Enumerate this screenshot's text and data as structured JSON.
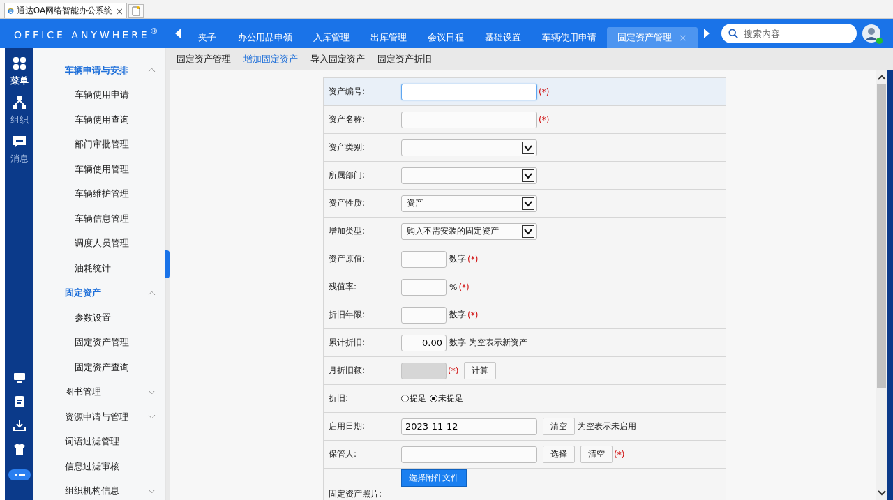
{
  "browser_tab": {
    "title": "通达OA网络智能办公系统",
    "close": "×"
  },
  "header": {
    "logo": "OFFICE ANYWHERE$^{®}$",
    "tabs": [
      {
        "label": "夹子",
        "selected": false,
        "closable": false
      },
      {
        "label": "办公用品申领",
        "selected": false,
        "closable": false
      },
      {
        "label": "入库管理",
        "selected": false,
        "closable": false
      },
      {
        "label": "出库管理",
        "selected": false,
        "closable": false
      },
      {
        "label": "会议日程",
        "selected": false,
        "closable": false
      },
      {
        "label": "基础设置",
        "selected": false,
        "closable": false
      },
      {
        "label": "车辆使用申请",
        "selected": false,
        "closable": false
      },
      {
        "label": "固定资产管理",
        "selected": true,
        "closable": true
      }
    ],
    "close_glyph": "×",
    "search": {
      "placeholder": "搜索内容"
    },
    "avatar": {
      "online": true
    }
  },
  "rail": {
    "items": [
      {
        "kind": "apps",
        "label": "菜单",
        "selected": true
      },
      {
        "kind": "org",
        "label": "组织",
        "selected": false
      },
      {
        "kind": "chat",
        "label": "消息",
        "selected": false
      }
    ],
    "tools": [
      {
        "kind": "monitor"
      },
      {
        "kind": "note"
      },
      {
        "kind": "download"
      },
      {
        "kind": "shirt"
      },
      {
        "kind": "toggle",
        "expanded": true
      }
    ]
  },
  "sidebar": {
    "items": [
      {
        "label": "车辆申请与安排",
        "kind": "group",
        "expanded": true,
        "children": [
          {
            "label": "车辆使用申请"
          },
          {
            "label": "车辆使用查询"
          },
          {
            "label": "部门审批管理"
          },
          {
            "label": "车辆使用管理"
          },
          {
            "label": "车辆维护管理"
          },
          {
            "label": "车辆信息管理"
          },
          {
            "label": "调度人员管理"
          },
          {
            "label": "油耗统计"
          }
        ]
      },
      {
        "label": "固定资产",
        "kind": "group",
        "expanded": true,
        "children": [
          {
            "label": "参数设置"
          },
          {
            "label": "固定资产管理"
          },
          {
            "label": "固定资产查询"
          }
        ]
      },
      {
        "label": "图书管理",
        "kind": "group",
        "expanded": false
      },
      {
        "label": "资源申请与管理",
        "kind": "group",
        "expanded": false
      },
      {
        "label": "词语过滤管理",
        "kind": "link"
      },
      {
        "label": "信息过滤审核",
        "kind": "link"
      },
      {
        "label": "组织机构信息",
        "kind": "group",
        "expanded": false
      }
    ]
  },
  "subtabs": [
    {
      "label": "固定资产管理",
      "selected": false
    },
    {
      "label": "增加固定资产",
      "selected": true
    },
    {
      "label": "导入固定资产",
      "selected": false
    },
    {
      "label": "固定资产折旧",
      "selected": false
    }
  ],
  "form": {
    "rows": [
      {
        "label": "资产编号:",
        "kind": "text",
        "focused": true,
        "parts": [
          {
            "kind": "required",
            "text": "(*)"
          }
        ]
      },
      {
        "label": "资产名称:",
        "kind": "text",
        "focused": false,
        "parts": [
          {
            "kind": "required",
            "text": "(*)"
          }
        ]
      },
      {
        "label": "资产类别:",
        "kind": "select",
        "value": ""
      },
      {
        "label": "所属部门:",
        "kind": "select",
        "value": ""
      },
      {
        "label": "资产性质:",
        "kind": "select",
        "value": "资产"
      },
      {
        "label": "增加类型:",
        "kind": "select",
        "value": "购入不需安装的固定资产"
      },
      {
        "label": "资产原值:",
        "kind": "number",
        "disabled": false,
        "parts": [
          {
            "kind": "note",
            "text": "数字"
          },
          {
            "kind": "required",
            "text": "(*)"
          }
        ]
      },
      {
        "label": "残值率:",
        "kind": "number",
        "disabled": false,
        "parts": [
          {
            "kind": "note",
            "text": "%"
          },
          {
            "kind": "required",
            "text": "(*)"
          }
        ]
      },
      {
        "label": "折旧年限:",
        "kind": "number",
        "disabled": false,
        "parts": [
          {
            "kind": "note",
            "text": "数字"
          },
          {
            "kind": "required",
            "text": "(*)"
          }
        ]
      },
      {
        "label": "累计折旧:",
        "kind": "number",
        "disabled": false,
        "value": "0.00",
        "parts": [
          {
            "kind": "note",
            "text": "数字 为空表示新资产"
          }
        ]
      },
      {
        "label": "月折旧额:",
        "kind": "number",
        "disabled": true,
        "parts": [
          {
            "kind": "required",
            "text": "(*)"
          },
          {
            "kind": "button",
            "text": "计算"
          }
        ]
      },
      {
        "label": "折旧:",
        "kind": "radio",
        "options": [
          {
            "label": "提足",
            "selected": false
          },
          {
            "label": "未提足",
            "selected": true
          }
        ]
      },
      {
        "label": "启用日期:",
        "kind": "text",
        "focused": false,
        "value": "2023-11-12",
        "parts": [
          {
            "kind": "button",
            "text": "清空"
          },
          {
            "kind": "note",
            "text": "为空表示未启用"
          }
        ]
      },
      {
        "label": "保管人:",
        "kind": "text",
        "focused": false,
        "parts": [
          {
            "kind": "button",
            "text": "选择"
          },
          {
            "kind": "button",
            "text": "清空"
          },
          {
            "kind": "required",
            "text": "(*)"
          }
        ]
      },
      {
        "label": "固定资产照片:",
        "kind": "file",
        "button": "选择附件文件"
      }
    ]
  }
}
